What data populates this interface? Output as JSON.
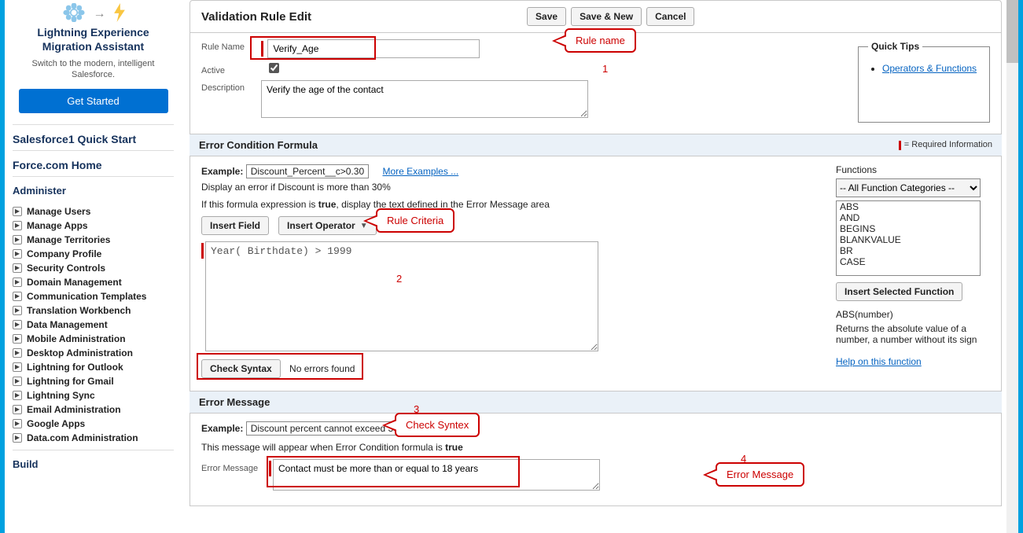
{
  "lightning": {
    "title_line1": "Lightning Experience",
    "title_line2": "Migration Assistant",
    "subtitle": "Switch to the modern, intelligent Salesforce.",
    "button": "Get Started"
  },
  "nav": {
    "quickstart": "Salesforce1 Quick Start",
    "forcehome": "Force.com Home",
    "administer": "Administer",
    "build": "Build",
    "items": [
      "Manage Users",
      "Manage Apps",
      "Manage Territories",
      "Company Profile",
      "Security Controls",
      "Domain Management",
      "Communication Templates",
      "Translation Workbench",
      "Data Management",
      "Mobile Administration",
      "Desktop Administration",
      "Lightning for Outlook",
      "Lightning for Gmail",
      "Lightning Sync",
      "Email Administration",
      "Google Apps",
      "Data.com Administration"
    ]
  },
  "buttons": {
    "save": "Save",
    "save_new": "Save & New",
    "cancel": "Cancel",
    "insert_field": "Insert Field",
    "insert_operator": "Insert Operator",
    "check_syntax": "Check Syntax",
    "insert_selected_fn": "Insert Selected Function"
  },
  "headers": {
    "rule_edit": "Validation Rule Edit",
    "formula": "Error Condition Formula",
    "error_message": "Error Message",
    "required_info": "= Required Information"
  },
  "labels": {
    "rule_name": "Rule Name",
    "active": "Active",
    "description": "Description",
    "example": "Example:",
    "error_message": "Error Message",
    "functions": "Functions"
  },
  "values": {
    "rule_name": "Verify_Age",
    "active_checked": true,
    "description": "Verify the age of the contact",
    "formula_example_box": "Discount_Percent__c>0.30",
    "more_examples": "More Examples ...",
    "formula_example_note": "Display an error if Discount is more than 30%",
    "formula_instruction_prefix": "If this formula expression is ",
    "formula_instruction_bold": "true",
    "formula_instruction_suffix": ", display the text defined in the Error Message area",
    "formula_text": "Year( Birthdate) > 1999",
    "syntax_result": "No errors found",
    "errmsg_example_box": "Discount percent cannot exceed 30%",
    "errmsg_note_prefix": "This message will appear when Error Condition formula is ",
    "errmsg_note_bold": "true",
    "error_message_value": "Contact must be more than or equal to 18 years"
  },
  "functions": {
    "category": "-- All Function Categories --",
    "list": [
      "ABS",
      "AND",
      "BEGINS",
      "BLANKVALUE",
      "BR",
      "CASE"
    ],
    "signature": "ABS(number)",
    "description": "Returns the absolute value of a number, a number without its sign",
    "help": "Help on this function"
  },
  "quick_tips": {
    "title": "Quick Tips",
    "link": "Operators & Functions"
  },
  "callouts": {
    "rule_name": "Rule name",
    "rule_criteria": "Rule Criteria",
    "check_syntax": "Check Syntex",
    "error_message": "Error Message",
    "n1": "1",
    "n2": "2",
    "n3": "3",
    "n4": "4"
  }
}
